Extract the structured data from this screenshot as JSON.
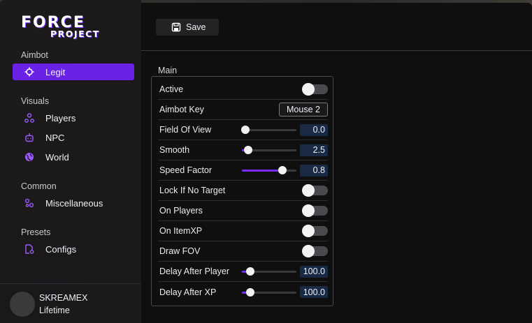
{
  "logo": {
    "line1": "FORCE",
    "line2": "PROJECT"
  },
  "sidebar": {
    "sections": [
      {
        "title": "Aimbot",
        "items": [
          {
            "label": "Legit",
            "icon": "crosshair-icon",
            "active": true
          }
        ]
      },
      {
        "title": "Visuals",
        "items": [
          {
            "label": "Players",
            "icon": "players-icon"
          },
          {
            "label": "NPC",
            "icon": "robot-icon"
          },
          {
            "label": "World",
            "icon": "globe-icon"
          }
        ]
      },
      {
        "title": "Common",
        "items": [
          {
            "label": "Miscellaneous",
            "icon": "misc-icon"
          }
        ]
      },
      {
        "title": "Presets",
        "items": [
          {
            "label": "Configs",
            "icon": "file-gear-icon"
          }
        ]
      }
    ]
  },
  "user": {
    "name": "SKREAMEX",
    "tier": "Lifetime"
  },
  "toolbar": {
    "save_label": "Save",
    "save_icon": "floppy-disk-icon"
  },
  "panel": {
    "title": "Main",
    "rows": [
      {
        "label": "Active",
        "type": "toggle",
        "on": false
      },
      {
        "label": "Aimbot Key",
        "type": "key",
        "value": "Mouse 2"
      },
      {
        "label": "Field Of View",
        "type": "slider",
        "value": "0.0",
        "level": 0.07
      },
      {
        "label": "Smooth",
        "type": "slider",
        "value": "2.5",
        "level": 0.11
      },
      {
        "label": "Speed Factor",
        "type": "slider",
        "value": "0.8",
        "level": 0.74
      },
      {
        "label": "Lock If No Target",
        "type": "toggle",
        "on": false
      },
      {
        "label": "On Players",
        "type": "toggle",
        "on": false
      },
      {
        "label": "On ItemXP",
        "type": "toggle",
        "on": false
      },
      {
        "label": "Draw FOV",
        "type": "toggle",
        "on": false
      },
      {
        "label": "Delay After Player",
        "type": "slider",
        "value": "100.0",
        "level": 0.15
      },
      {
        "label": "Delay After XP",
        "type": "slider",
        "value": "100.0",
        "level": 0.15
      }
    ]
  },
  "colors": {
    "accent": "#6a22e6",
    "slider_fill": "#7a2cff",
    "value_box": "#1a2a44"
  }
}
